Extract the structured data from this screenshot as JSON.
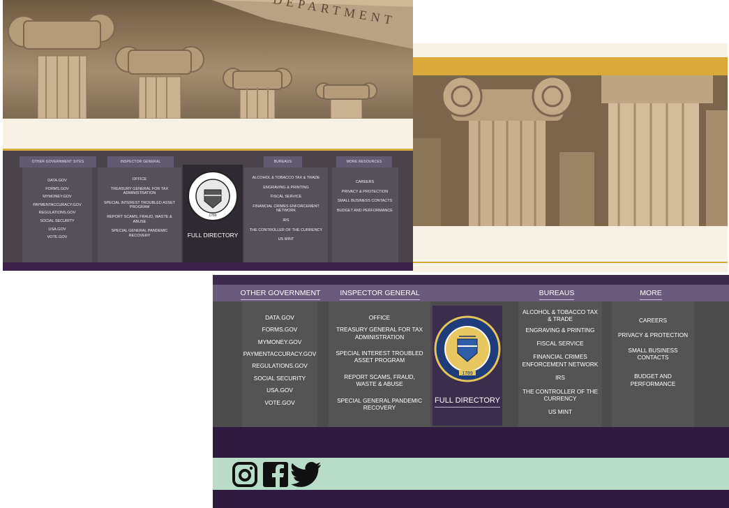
{
  "hero": {
    "engraving": "DEPARTMENT"
  },
  "footer": {
    "headers": {
      "other_government_sites": "OTHER GOVERNMENT SITES",
      "inspector_general": "INSPECTOR GENERAL",
      "bureaus": "BUREAUS",
      "more_resources": "MORE RESOURCES"
    },
    "other_government_sites": [
      "DATA.GOV",
      "FORMS.GOV",
      "MYMONEY.GOV",
      "PAYMENTACCURACY.GOV",
      "REGULATIONS.GOV",
      "SOCIAL SECURITY",
      "USA.GOV",
      "VOTE.GOV"
    ],
    "inspector_general": [
      "OFFICE",
      "TREASURY GENERAL FOR TAX ADMINISTRATION",
      "SPECIAL INTEREST TROUBLED ASSET PROGRAM",
      "REPORT SCAMS, FRAUD, WASTE & ABUSE",
      "SPECIAL GENERAL PANDEMIC RECOVERY"
    ],
    "bureaus": [
      "ALCOHOL & TOBACCO TAX & TRADE",
      "ENGRAVING & PRINTING",
      "FISCAL SERVICE",
      "FINANCIAL CRIMES ENFORCEMENT NETWORK",
      "IRS",
      "THE CONTROLLER OF THE CURRENCY",
      "US MINT"
    ],
    "more_resources": [
      "CAREERS",
      "PRIVACY & PROTECTION",
      "SMALL BUSINESS CONTACTS",
      "BUDGET AND PERFORMANCE"
    ],
    "full_directory": "FULL DIRECTORY",
    "seal": {
      "text": "THE DEPARTMENT OF THE TREASURY",
      "year": "1789"
    }
  },
  "social": [
    "instagram-icon",
    "facebook-icon",
    "twitter-icon"
  ],
  "colors": {
    "gold": "#d9a93a",
    "cream": "#f6f1e4",
    "purple": "#2f1b3f",
    "mint": "#b8dcc8",
    "gray": "#4a4b4a"
  }
}
